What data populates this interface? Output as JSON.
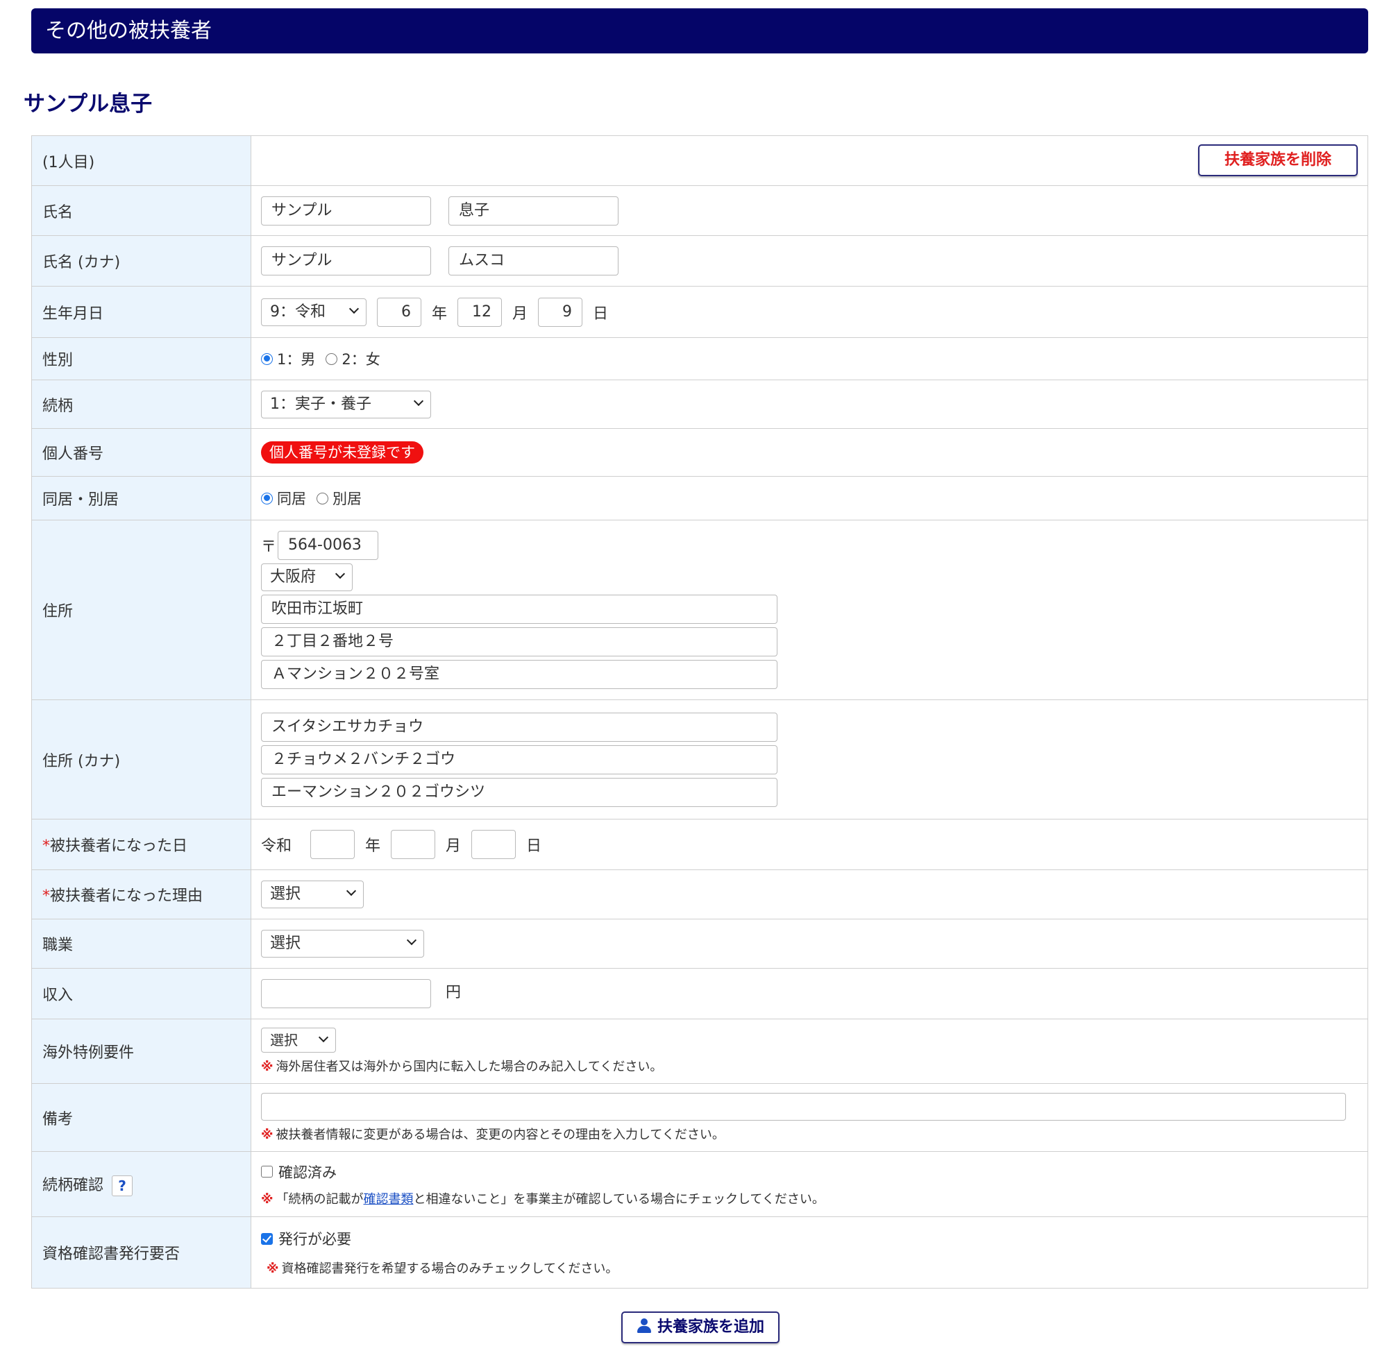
{
  "header": {
    "title": "その他の被扶養者"
  },
  "person": {
    "display_name": "サンプル息子"
  },
  "rows": {
    "index": {
      "label": "(1人目)",
      "delete_button": "扶養家族を削除"
    },
    "name": {
      "label": "氏名",
      "last": "サンプル",
      "first": "息子"
    },
    "name_kana": {
      "label": "氏名 (カナ)",
      "last": "サンプル",
      "first": "ムスコ"
    },
    "birth": {
      "label": "生年月日",
      "era": "9：令和",
      "year": "6",
      "year_unit": "年",
      "month": "12",
      "month_unit": "月",
      "day": "9",
      "day_unit": "日"
    },
    "gender": {
      "label": "性別",
      "opt1": "1：男",
      "opt2": "2：女",
      "selected": "1：男"
    },
    "relation": {
      "label": "続柄",
      "value": "1：実子・養子"
    },
    "my_number": {
      "label": "個人番号",
      "badge": "個人番号が未登録です"
    },
    "cohabit": {
      "label": "同居・別居",
      "opt1": "同居",
      "opt2": "別居",
      "selected": "同居"
    },
    "address": {
      "label": "住所",
      "postal_mark": "〒",
      "postal": "564-0063",
      "prefecture": "大阪府",
      "line1": "吹田市江坂町",
      "line2": "２丁目２番地２号",
      "line3": "Ａマンション２０２号室"
    },
    "address_kana": {
      "label": "住所 (カナ)",
      "line1": "スイタシエサカチョウ",
      "line2": "２チョウメ２バンチ２ゴウ",
      "line3": "エーマンション２０２ゴウシツ"
    },
    "dependent_date": {
      "required_mark": "*",
      "label": "被扶養者になった日",
      "era": "令和",
      "year_unit": "年",
      "month_unit": "月",
      "day_unit": "日",
      "year": "",
      "month": "",
      "day": ""
    },
    "dependent_reason": {
      "required_mark": "*",
      "label": "被扶養者になった理由",
      "value": "選択"
    },
    "occupation": {
      "label": "職業",
      "value": "選択"
    },
    "income": {
      "label": "収入",
      "value": "",
      "unit": "円"
    },
    "overseas": {
      "label": "海外特例要件",
      "value": "選択",
      "note_mark": "※",
      "note": "海外居住者又は海外から国内に転入した場合のみ記入してください。"
    },
    "remarks": {
      "label": "備考",
      "value": "",
      "note_mark": "※",
      "note": "被扶養者情報に変更がある場合は、変更の内容とその理由を入力してください。"
    },
    "relation_check": {
      "label": "続柄確認",
      "help": "?",
      "checkbox_label": "確認済み",
      "checked": false,
      "note_mark": "※",
      "note_before": "「続柄の記載が",
      "note_link": "確認書類",
      "note_after": "と相違ないこと」を事業主が確認している場合にチェックしてください。"
    },
    "certificate": {
      "label": "資格確認書発行要否",
      "checkbox_label": "発行が必要",
      "checked": true,
      "note_mark": "※",
      "note": "資格確認書発行を希望する場合のみチェックしてください。"
    }
  },
  "footer": {
    "add_button": "扶養家族を追加"
  },
  "colors": {
    "header_bg": "#050568",
    "label_bg": "#eaf4fd",
    "accent_red": "#e02020",
    "accent_blue": "#1a73e8"
  }
}
